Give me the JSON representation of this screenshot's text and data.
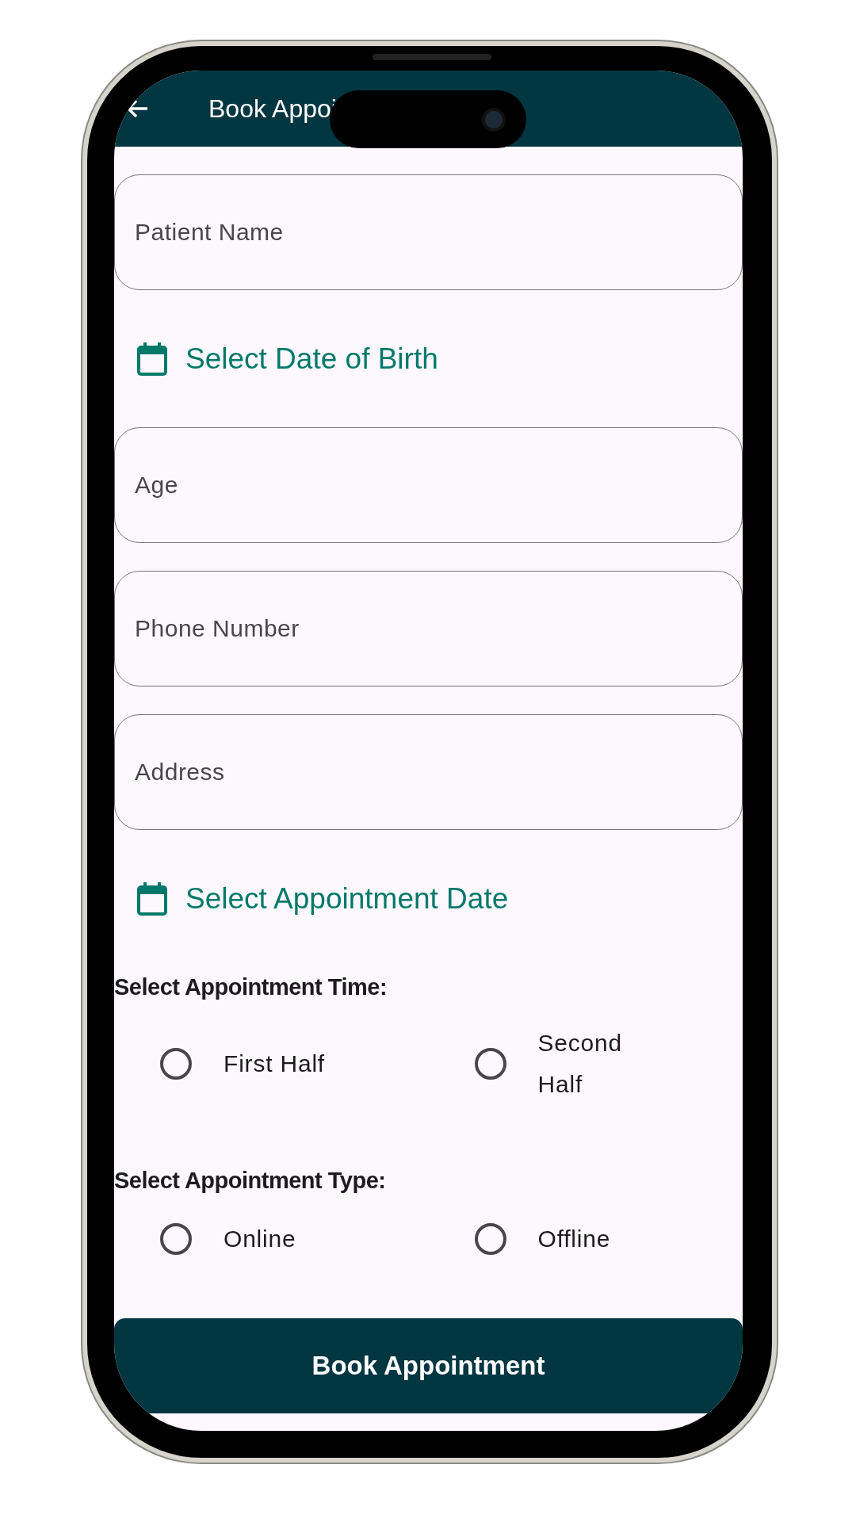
{
  "app_bar": {
    "title": "Book Appoi"
  },
  "form": [
    {
      "kind": "field",
      "placeholder": "Patient Name"
    },
    {
      "kind": "date",
      "label": "Select Date of Birth"
    },
    {
      "kind": "field",
      "placeholder": "Age"
    },
    {
      "kind": "field",
      "placeholder": "Phone Number"
    },
    {
      "kind": "field",
      "placeholder": "Address"
    },
    {
      "kind": "date",
      "label": "Select Appointment Date"
    }
  ],
  "radio_groups": [
    {
      "title": "Select Appointment Time:",
      "options": [
        {
          "label": "First Half",
          "selected": false
        },
        {
          "label": "Second Half",
          "selected": false
        }
      ]
    },
    {
      "title": "Select Appointment Type:",
      "options": [
        {
          "label": "Online",
          "selected": false
        },
        {
          "label": "Offline",
          "selected": false
        }
      ]
    }
  ],
  "submit_button": "Book Appointment"
}
